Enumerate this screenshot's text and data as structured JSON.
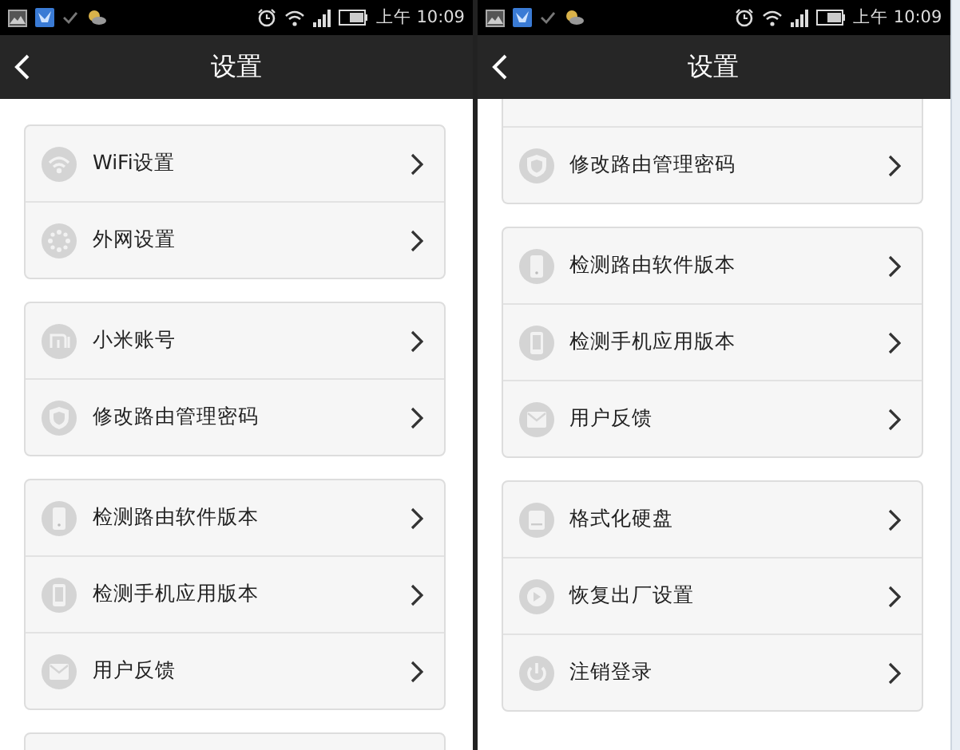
{
  "screens": [
    {
      "status_bar": {
        "time": "上午 10:09"
      },
      "title": "设置",
      "more_below": true,
      "groups": [
        {
          "rows": [
            {
              "kind": "wifi",
              "label": "WiFi设置"
            },
            {
              "kind": "globe",
              "label": "外网设置"
            }
          ]
        },
        {
          "rows": [
            {
              "kind": "mi",
              "label": "小米账号"
            },
            {
              "kind": "shield",
              "label": "修改路由管理密码"
            }
          ]
        },
        {
          "rows": [
            {
              "kind": "router",
              "label": "检测路由软件版本"
            },
            {
              "kind": "phone",
              "label": "检测手机应用版本"
            },
            {
              "kind": "mail",
              "label": "用户反馈"
            }
          ]
        }
      ]
    },
    {
      "status_bar": {
        "time": "上午 10:09"
      },
      "title": "设置",
      "more_below": false,
      "groups": [
        {
          "rows": [
            {
              "kind": "cut"
            },
            {
              "kind": "shield",
              "label": "修改路由管理密码"
            }
          ]
        },
        {
          "rows": [
            {
              "kind": "router",
              "label": "检测路由软件版本"
            },
            {
              "kind": "phone",
              "label": "检测手机应用版本"
            },
            {
              "kind": "mail",
              "label": "用户反馈"
            }
          ]
        },
        {
          "rows": [
            {
              "kind": "disk",
              "label": "格式化硬盘"
            },
            {
              "kind": "restore",
              "label": "恢复出厂设置"
            },
            {
              "kind": "power",
              "label": "注销登录"
            }
          ]
        }
      ]
    }
  ]
}
